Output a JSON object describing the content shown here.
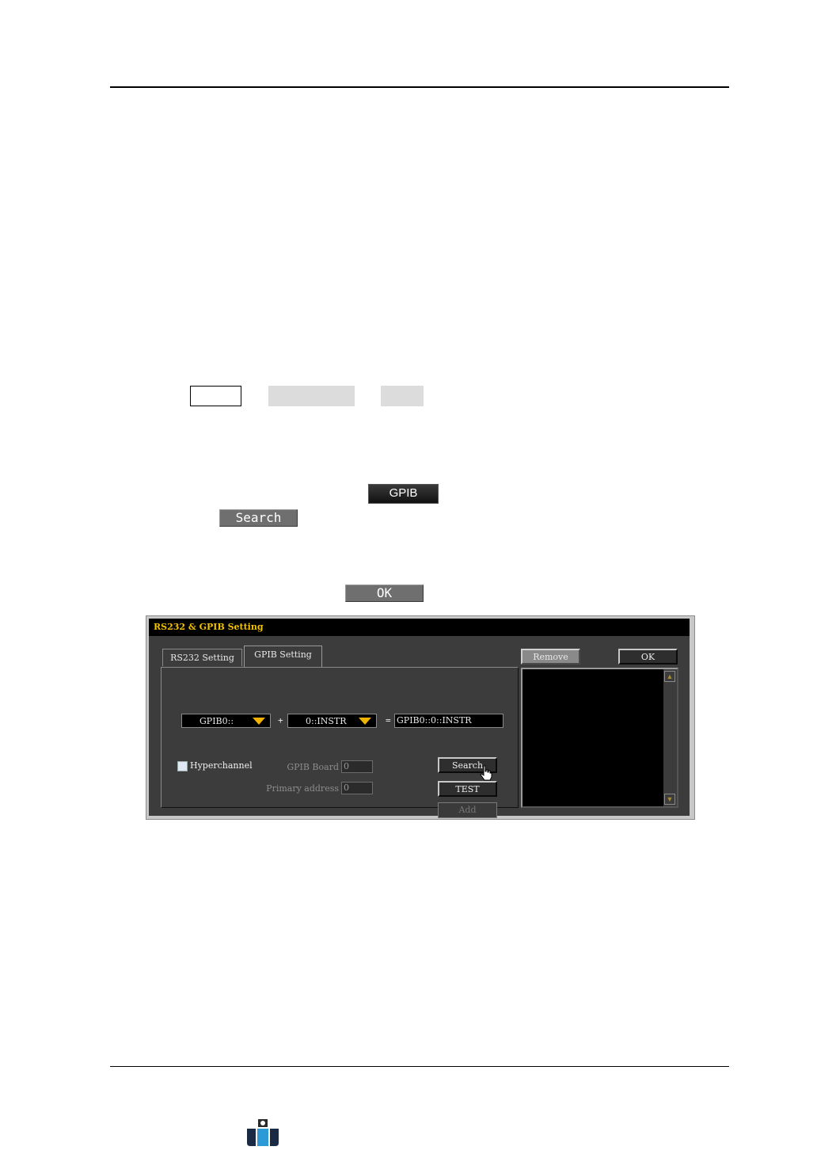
{
  "chips": {
    "gpib": "GPIB",
    "search": "Search",
    "ok": "OK"
  },
  "dialog": {
    "title": "RS232 & GPIB Setting",
    "tabs": [
      "RS232 Setting",
      "GPIB Setting"
    ],
    "active_tab": "GPIB Setting",
    "combo1_value": "GPIB0::",
    "plus": "+",
    "combo2_value": "0::INSTR",
    "equals": "=",
    "result_value": "GPIB0::0::INSTR",
    "hyperchannel_label": "Hyperchannel",
    "hyperchannel_checked": false,
    "gpib_board_label": "GPIB Board",
    "gpib_board_value": "0",
    "primary_address_label": "Primary address",
    "primary_address_value": "0",
    "buttons": {
      "search": "Search",
      "test": "TEST",
      "add": "Add",
      "remove": "Remove",
      "ok": "OK"
    },
    "colors": {
      "title_text": "#f2c200",
      "arrow": "#f2b200",
      "body": "#3c3c3c"
    }
  },
  "icons": {
    "cursor": "hand-pointer-icon",
    "logo": "brand-logo-icon",
    "scroll_up": "scroll-up-arrow-icon",
    "scroll_down": "scroll-down-arrow-icon",
    "dropdown": "dropdown-arrow-icon"
  }
}
